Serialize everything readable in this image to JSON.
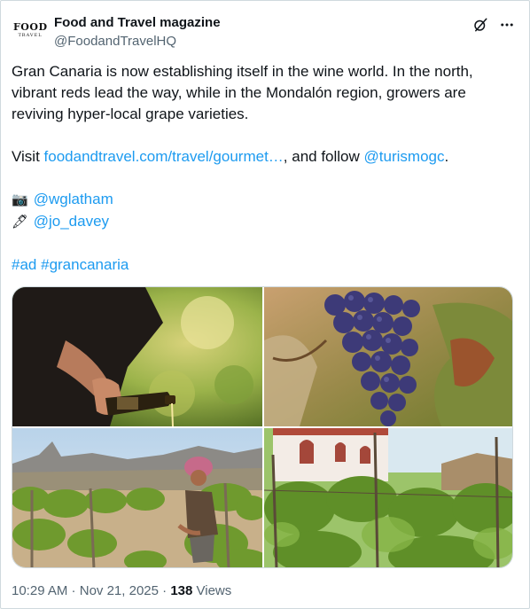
{
  "account": {
    "avatar_line1": "FOOD",
    "avatar_line2": "TRAVEL",
    "display_name": "Food and Travel magazine",
    "handle": "@FoodandTravelHQ"
  },
  "icons": {
    "grok": "grok-icon",
    "more": "more-options-icon"
  },
  "tweet": {
    "paragraph1": "Gran Canaria is now establishing itself in the wine world. In the north, vibrant reds lead the way, while in the Mondalón region, growers are reviving hyper-local grape varieties.",
    "visit_prefix": "Visit ",
    "visit_link": "foodandtravel.com/travel/gourmet…",
    "visit_middle": ", and follow ",
    "follow_mention": "@turismogc",
    "visit_suffix": ".",
    "credit_photo_emoji": "📷",
    "credit_photo_mention": "@wglatham",
    "credit_writer_emoji": "🖋",
    "credit_writer_mention": "@jo_davey",
    "hashtag1": "#ad",
    "hashtag2": "#grancanaria"
  },
  "media": [
    {
      "name": "wine-pouring-photo"
    },
    {
      "name": "grape-bunch-photo"
    },
    {
      "name": "vineyard-worker-photo"
    },
    {
      "name": "vineyard-house-photo"
    }
  ],
  "meta": {
    "time": "10:29 AM",
    "separator": " · ",
    "date": "Nov 21, 2025",
    "dot": " · ",
    "views_count": "138",
    "views_label": " Views"
  },
  "colors": {
    "link": "#1d9bf0",
    "secondary_text": "#536471",
    "primary_text": "#0f1419",
    "border": "#cfd9de"
  }
}
